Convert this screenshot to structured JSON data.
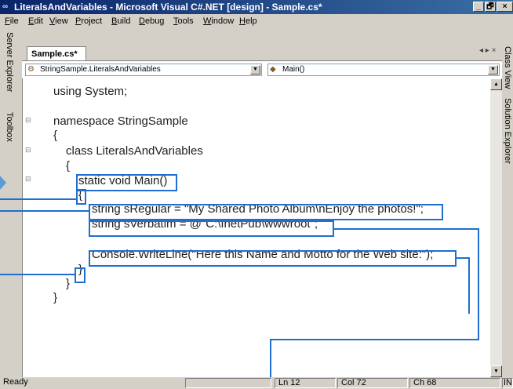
{
  "window": {
    "title": "LiteralsAndVariables - Microsoft Visual C#.NET [design] - Sample.cs*",
    "app_icon": "visual-studio-icon",
    "min_label": "_",
    "restore_label": "🗗",
    "close_label": "×"
  },
  "menu": [
    "File",
    "Edit",
    "View",
    "Project",
    "Build",
    "Debug",
    "Tools",
    "Window",
    "Help"
  ],
  "left_tabs": {
    "server_explorer": "Server Explorer",
    "toolbox": "Toolbox"
  },
  "right_tabs": {
    "class_view": "Class View",
    "solution_explorer": "Solution Explorer"
  },
  "doc_tab": {
    "label": "Sample.cs*",
    "nav": "◂ ▸ ×"
  },
  "combos": {
    "type": "StringSample.LiteralsAndVariables",
    "member": "Main()"
  },
  "code": [
    "using System;",
    "namespace StringSample",
    "{",
    "class LiteralsAndVariables",
    "{",
    "static void Main()",
    "{",
    "string sRegular = \"My Shared Photo Album\\nEnjoy the photos!\";",
    "string sVerbatim = @\"C:\\InetPub\\wwwroot\";",
    "Console.WriteLine(\"Here this Name and Motto for the Web site:\");",
    "}",
    "}",
    "}"
  ],
  "status": {
    "ready": "Ready",
    "line": "Ln 12",
    "col": "Col 72",
    "ch": "Ch 68",
    "mode": "INS"
  },
  "colors": {
    "highlight": "#1e6fd0",
    "titlebar": "#0a246a"
  }
}
